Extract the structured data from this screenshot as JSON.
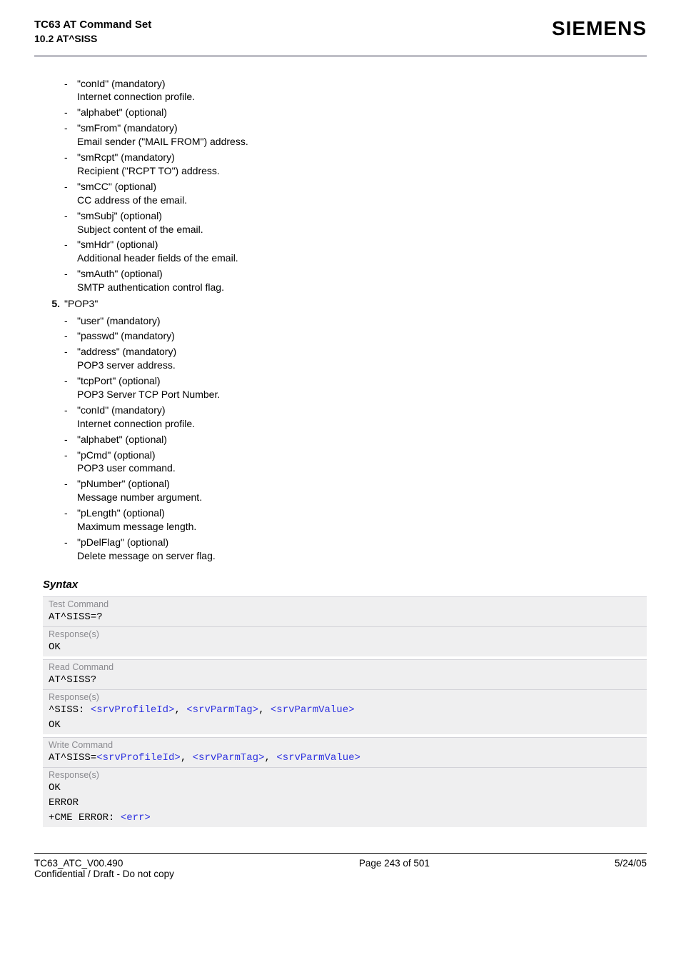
{
  "header": {
    "title": "TC63 AT Command Set",
    "subtitle": "10.2 AT^SISS",
    "brand": "SIEMENS"
  },
  "list_pre": [
    {
      "term": "\"conId\" (mandatory)",
      "desc": "Internet connection profile."
    },
    {
      "term": "\"alphabet\" (optional)",
      "desc": ""
    },
    {
      "term": "\"smFrom\" (mandatory)",
      "desc": "Email sender (\"MAIL FROM\") address."
    },
    {
      "term": "\"smRcpt\" (mandatory)",
      "desc": "Recipient (\"RCPT TO\") address."
    },
    {
      "term": "\"smCC\" (optional)",
      "desc": "CC address of the email."
    },
    {
      "term": "\"smSubj\" (optional)",
      "desc": "Subject content of the email."
    },
    {
      "term": "\"smHdr\" (optional)",
      "desc": "Additional header fields of the email."
    },
    {
      "term": "\"smAuth\" (optional)",
      "desc": "SMTP authentication control flag."
    }
  ],
  "numbered": {
    "num": "5.",
    "label": "\"POP3\""
  },
  "list_post": [
    {
      "term": "\"user\" (mandatory)",
      "desc": ""
    },
    {
      "term": "\"passwd\" (mandatory)",
      "desc": ""
    },
    {
      "term": "\"address\" (mandatory)",
      "desc": "POP3 server address."
    },
    {
      "term": "\"tcpPort\" (optional)",
      "desc": "POP3 Server TCP Port Number."
    },
    {
      "term": "\"conId\" (mandatory)",
      "desc": "Internet connection profile."
    },
    {
      "term": "\"alphabet\" (optional)",
      "desc": ""
    },
    {
      "term": "\"pCmd\" (optional)",
      "desc": "POP3 user command."
    },
    {
      "term": "\"pNumber\" (optional)",
      "desc": "Message number argument."
    },
    {
      "term": "\"pLength\" (optional)",
      "desc": "Maximum message length."
    },
    {
      "term": "\"pDelFlag\" (optional)",
      "desc": "Delete message on server flag."
    }
  ],
  "syntax": {
    "heading": "Syntax",
    "test_label": "Test Command",
    "test_cmd": "AT^SISS=?",
    "resp_label": "Response(s)",
    "ok": "OK",
    "read_label": "Read Command",
    "read_cmd": "AT^SISS?",
    "read_resp_prefix": "^SISS: ",
    "p1": "<srvProfileId>",
    "p2": "<srvParmTag>",
    "p3": "<srvParmValue>",
    "comma": ", ",
    "write_label": "Write Command",
    "write_cmd_prefix": "AT^SISS=",
    "error": "ERROR",
    "cme_prefix": "+CME ERROR: ",
    "err_param": "<err>"
  },
  "footer": {
    "doc_id": "TC63_ATC_V00.490",
    "conf": "Confidential / Draft - Do not copy",
    "page": "Page 243 of 501",
    "date": "5/24/05"
  }
}
